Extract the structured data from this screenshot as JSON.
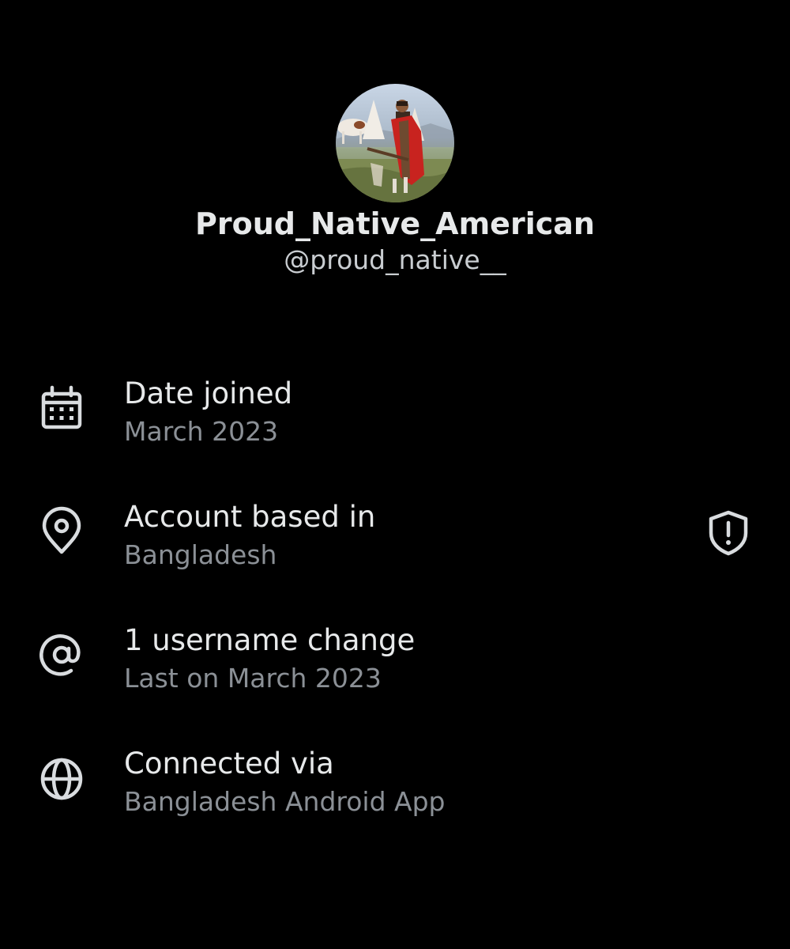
{
  "profile": {
    "display_name": "Proud_Native_American",
    "handle": "@proud_native__"
  },
  "rows": [
    {
      "icon": "calendar-icon",
      "title": "Date joined",
      "subtitle": "March 2023"
    },
    {
      "icon": "location-pin-icon",
      "title": "Account based in",
      "subtitle": "Bangladesh",
      "trailing_icon": "shield-alert-icon"
    },
    {
      "icon": "at-sign-icon",
      "title": "1 username change",
      "subtitle": "Last on March 2023"
    },
    {
      "icon": "globe-icon",
      "title": "Connected via",
      "subtitle": "Bangladesh Android App"
    }
  ],
  "colors": {
    "background": "#000000",
    "primary_text": "#e7e9ea",
    "secondary_text": "#8b9096",
    "icon": "#d9dcdf"
  }
}
